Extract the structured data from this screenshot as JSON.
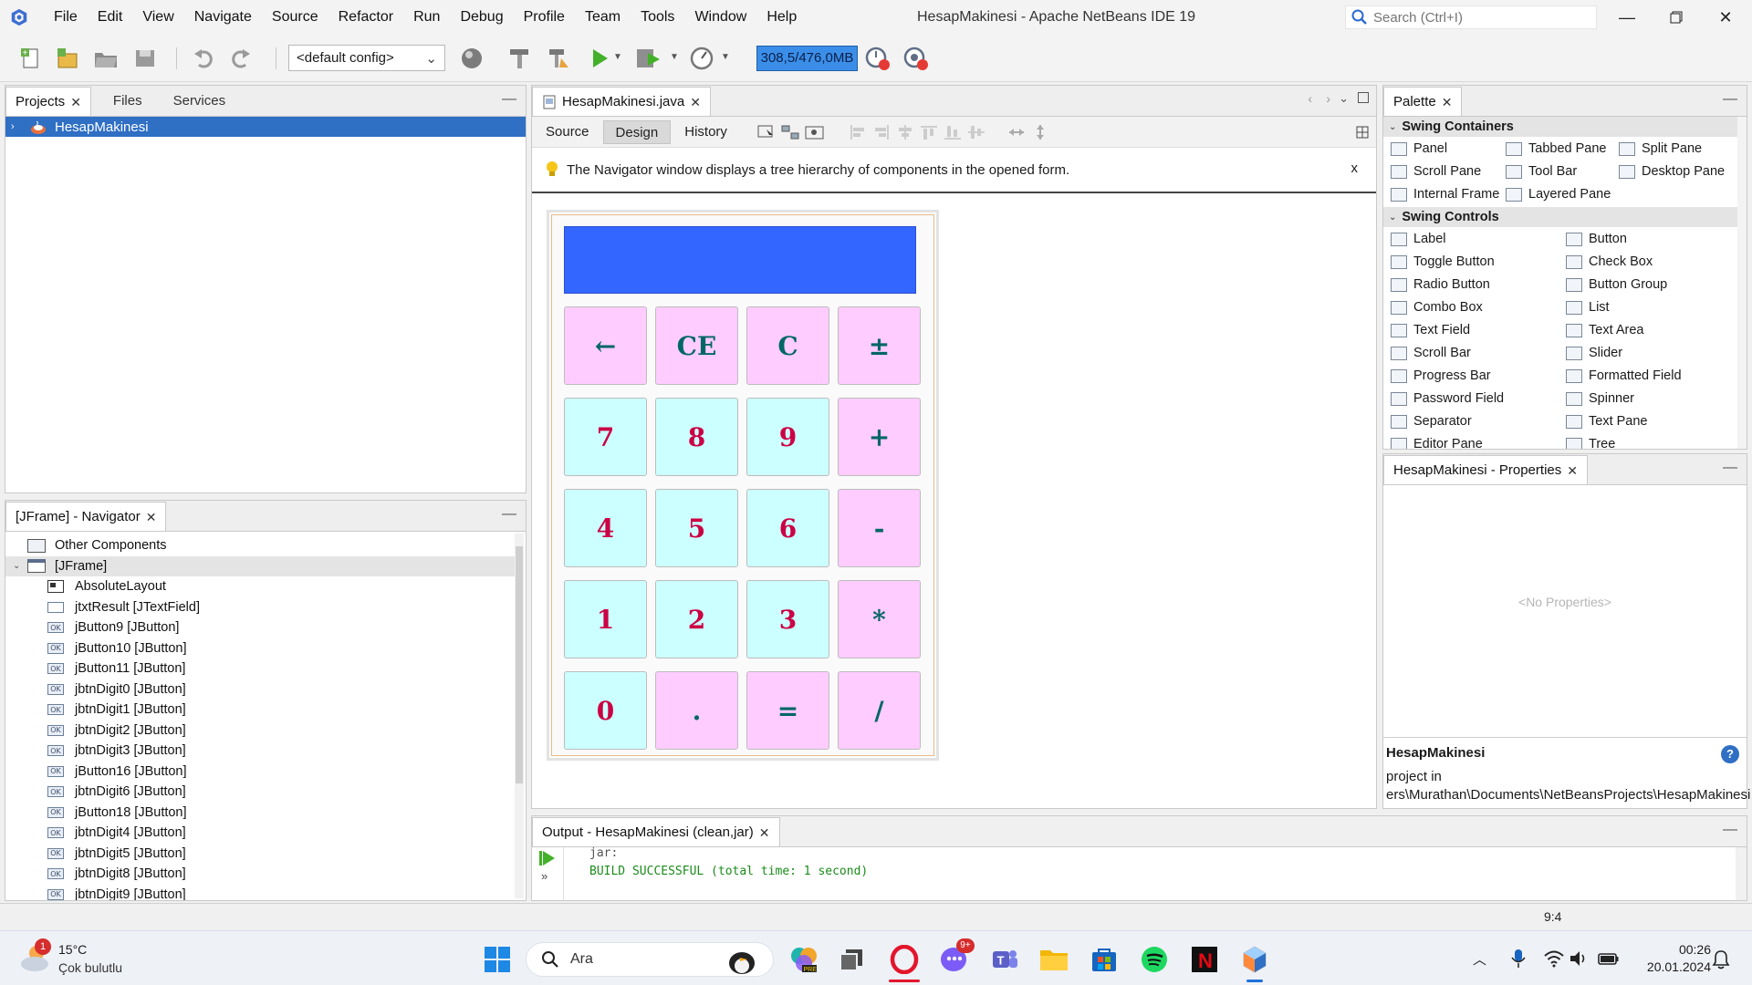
{
  "titlebar": {
    "menus": [
      "File",
      "Edit",
      "View",
      "Navigate",
      "Source",
      "Refactor",
      "Run",
      "Debug",
      "Profile",
      "Team",
      "Tools",
      "Window",
      "Help"
    ],
    "title": "HesapMakinesi - Apache NetBeans IDE 19",
    "search_placeholder": "Search (Ctrl+I)"
  },
  "toolbar": {
    "config": "<default config>",
    "memory": "308,5/476,0MB"
  },
  "projects": {
    "tabs": [
      "Projects",
      "Files",
      "Services"
    ],
    "root": "HesapMakinesi"
  },
  "navigator": {
    "title": "[JFrame] - Navigator",
    "items": [
      {
        "label": "Other Components",
        "indent": 0,
        "icon": "components-icon"
      },
      {
        "label": "[JFrame]",
        "indent": 0,
        "icon": "frame-icon"
      },
      {
        "label": "AbsoluteLayout",
        "indent": 1,
        "icon": "layout-icon"
      },
      {
        "label": "jtxtResult [JTextField]",
        "indent": 1,
        "icon": "textfield-icon"
      },
      {
        "label": "jButton9 [JButton]",
        "indent": 1,
        "icon": "button-icon"
      },
      {
        "label": "jButton10 [JButton]",
        "indent": 1,
        "icon": "button-icon"
      },
      {
        "label": "jButton11 [JButton]",
        "indent": 1,
        "icon": "button-icon"
      },
      {
        "label": "jbtnDigit0 [JButton]",
        "indent": 1,
        "icon": "button-icon"
      },
      {
        "label": "jbtnDigit1 [JButton]",
        "indent": 1,
        "icon": "button-icon"
      },
      {
        "label": "jbtnDigit2 [JButton]",
        "indent": 1,
        "icon": "button-icon"
      },
      {
        "label": "jbtnDigit3 [JButton]",
        "indent": 1,
        "icon": "button-icon"
      },
      {
        "label": "jButton16 [JButton]",
        "indent": 1,
        "icon": "button-icon"
      },
      {
        "label": "jbtnDigit6 [JButton]",
        "indent": 1,
        "icon": "button-icon"
      },
      {
        "label": "jButton18 [JButton]",
        "indent": 1,
        "icon": "button-icon"
      },
      {
        "label": "jbtnDigit4 [JButton]",
        "indent": 1,
        "icon": "button-icon"
      },
      {
        "label": "jbtnDigit5 [JButton]",
        "indent": 1,
        "icon": "button-icon"
      },
      {
        "label": "jbtnDigit8 [JButton]",
        "indent": 1,
        "icon": "button-icon"
      },
      {
        "label": "jbtnDigit9 [JButton]",
        "indent": 1,
        "icon": "button-icon"
      }
    ]
  },
  "editor": {
    "file_tab": "HesapMakinesi.java",
    "subtabs": [
      "Source",
      "Design",
      "History"
    ],
    "hint": "The Navigator window displays a tree hierarchy of components in the opened form.",
    "hint_close": "x"
  },
  "calculator": {
    "buttons": [
      {
        "label": "←",
        "style": "pink"
      },
      {
        "label": "CE",
        "style": "pink"
      },
      {
        "label": "C",
        "style": "pink"
      },
      {
        "label": "±",
        "style": "pink"
      },
      {
        "label": "7",
        "style": "cyan"
      },
      {
        "label": "8",
        "style": "cyan"
      },
      {
        "label": "9",
        "style": "cyan"
      },
      {
        "label": "+",
        "style": "pink"
      },
      {
        "label": "4",
        "style": "cyan"
      },
      {
        "label": "5",
        "style": "cyan"
      },
      {
        "label": "6",
        "style": "cyan"
      },
      {
        "label": "-",
        "style": "pink"
      },
      {
        "label": "1",
        "style": "cyan"
      },
      {
        "label": "2",
        "style": "cyan"
      },
      {
        "label": "3",
        "style": "cyan"
      },
      {
        "label": "*",
        "style": "pink"
      },
      {
        "label": "0",
        "style": "cyan"
      },
      {
        "label": ".",
        "style": "pink"
      },
      {
        "label": "=",
        "style": "pink"
      },
      {
        "label": "/",
        "style": "pink"
      }
    ]
  },
  "palette": {
    "title": "Palette",
    "categories": [
      {
        "name": "Swing Containers",
        "rows": [
          [
            "Panel",
            "Tabbed Pane",
            "Split Pane"
          ],
          [
            "Scroll Pane",
            "Tool Bar",
            "Desktop Pane"
          ],
          [
            "Internal Frame",
            "Layered Pane"
          ]
        ]
      },
      {
        "name": "Swing Controls",
        "rows": [
          [
            "Label",
            "Button"
          ],
          [
            "Toggle Button",
            "Check Box"
          ],
          [
            "Radio Button",
            "Button Group"
          ],
          [
            "Combo Box",
            "List"
          ],
          [
            "Text Field",
            "Text Area"
          ],
          [
            "Scroll Bar",
            "Slider"
          ],
          [
            "Progress Bar",
            "Formatted Field"
          ],
          [
            "Password Field",
            "Spinner"
          ],
          [
            "Separator",
            "Text Pane"
          ],
          [
            "Editor Pane",
            "Tree"
          ]
        ]
      }
    ]
  },
  "properties": {
    "title": "HesapMakinesi - Properties",
    "empty": "<No Properties>",
    "help_title": "HesapMakinesi",
    "help_line1": "project in",
    "help_line2": "ers\\Murathan\\Documents\\NetBeansProjects\\HesapMakinesi"
  },
  "output": {
    "title": "Output - HesapMakinesi (clean,jar)",
    "lines": [
      "jar:",
      "BUILD SUCCESSFUL (total time: 1 second)"
    ]
  },
  "status": {
    "position": "9:4"
  },
  "taskbar": {
    "weather_temp": "15°C",
    "weather_desc": "Çok bulutlu",
    "weather_badge": "1",
    "search_label": "Ara",
    "chat_badge": "9+",
    "time": "00:26",
    "date": "20.01.2024"
  },
  "colors": {
    "accent": "#2f6fc4",
    "display": "#3366ff",
    "btn_pink": "#ffccff",
    "btn_cyan": "#ccffff",
    "memory": "#3b8ee8",
    "success": "#1a8c1a"
  }
}
